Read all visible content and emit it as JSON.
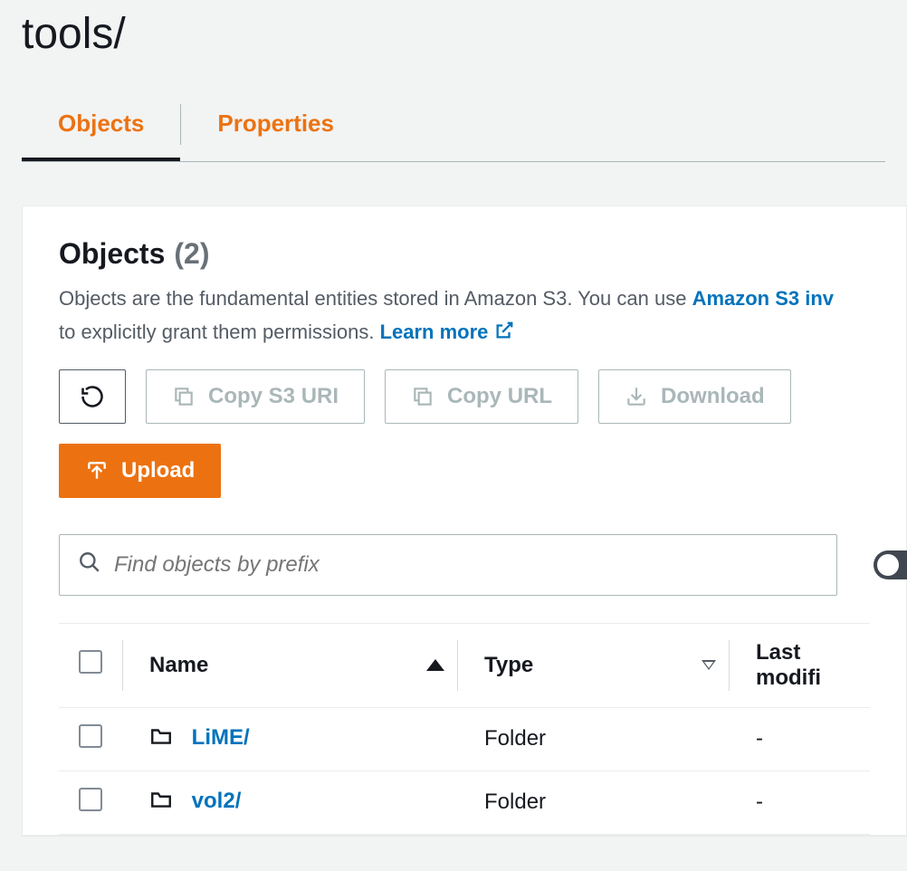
{
  "page_title": "tools/",
  "tabs": {
    "objects": "Objects",
    "properties": "Properties"
  },
  "panel": {
    "title": "Objects",
    "count": "(2)",
    "description_part1": "Objects are the fundamental entities stored in Amazon S3. You can use ",
    "description_link1": "Amazon S3 inv",
    "description_part2": "to explicitly grant them permissions. ",
    "description_link2": "Learn more"
  },
  "toolbar": {
    "copy_s3_uri": "Copy S3 URI",
    "copy_url": "Copy URL",
    "download": "Download",
    "upload": "Upload"
  },
  "search": {
    "placeholder": "Find objects by prefix"
  },
  "table": {
    "headers": {
      "name": "Name",
      "type": "Type",
      "last_modified": "Last modifi"
    },
    "rows": [
      {
        "name": "LiME/",
        "type": "Folder",
        "last_modified": "-"
      },
      {
        "name": "vol2/",
        "type": "Folder",
        "last_modified": "-"
      }
    ]
  }
}
